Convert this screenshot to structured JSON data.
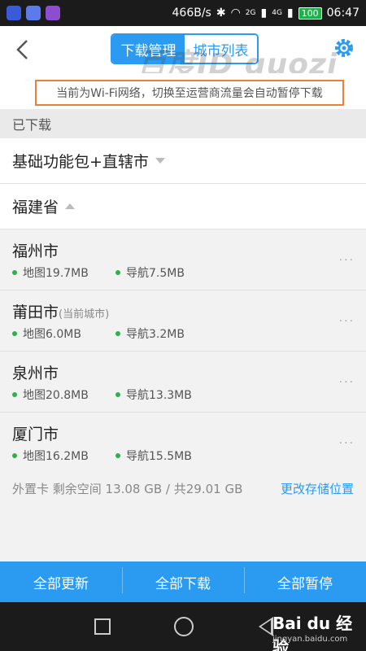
{
  "status_bar": {
    "speed": "466B/s",
    "network_2g": "2G",
    "network_4g": "4G",
    "battery": "100",
    "time": "06:47",
    "app_icon_colors": [
      "#3a5bd9",
      "#5b7be8",
      "#8c4ecf"
    ]
  },
  "header": {
    "tabs": [
      "下载管理",
      "城市列表"
    ],
    "active_tab": 0,
    "watermark": "百度ID guozi"
  },
  "notice": "当前为Wi-Fi网络，切换至运营商流量会自动暂停下载",
  "section_label": "已下载",
  "groups": [
    {
      "label": "基础功能包+直辖市"
    },
    {
      "label": "福建省"
    }
  ],
  "cities": [
    {
      "name": "福州市",
      "subtitle": "",
      "map_size": "地图19.7MB",
      "nav_size": "导航7.5MB"
    },
    {
      "name": "莆田市",
      "subtitle": "(当前城市)",
      "map_size": "地图6.0MB",
      "nav_size": "导航3.2MB"
    },
    {
      "name": "泉州市",
      "subtitle": "",
      "map_size": "地图20.8MB",
      "nav_size": "导航13.3MB"
    },
    {
      "name": "厦门市",
      "subtitle": "",
      "map_size": "地图16.2MB",
      "nav_size": "导航15.5MB"
    }
  ],
  "more_label": "···",
  "storage": {
    "info": "外置卡 剩余空间 13.08 GB / 共29.01 GB",
    "change_label": "更改存储位置"
  },
  "bottom_bar": [
    "全部更新",
    "全部下载",
    "全部暂停"
  ],
  "watermark_bottom": {
    "brand": "Bai du 经验",
    "url": "jingyan.baidu.com"
  },
  "colors": {
    "accent": "#2a9bf0",
    "notice_border": "#e8823a",
    "dot": "#2cb24a"
  }
}
